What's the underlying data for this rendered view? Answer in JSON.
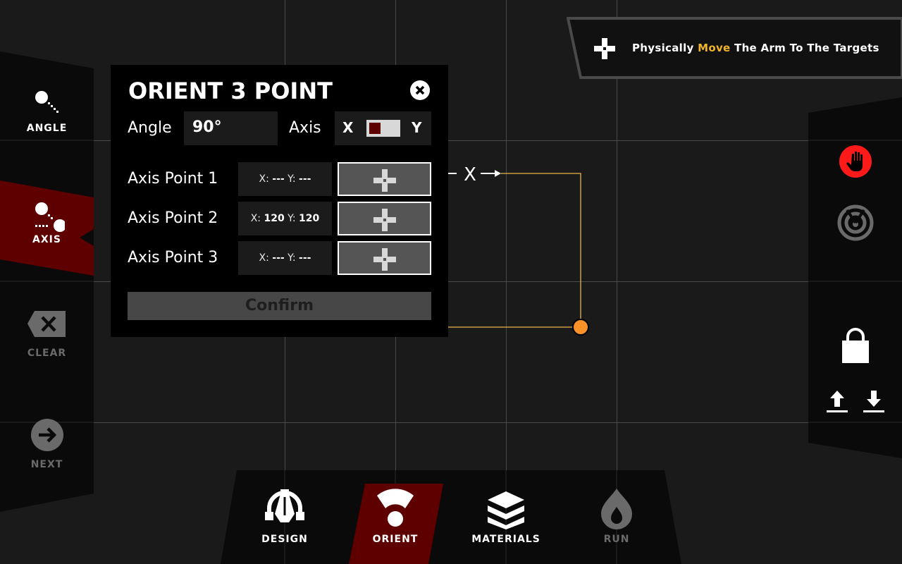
{
  "sidebar": {
    "items": [
      {
        "label": "ANGLE",
        "icon": "angle-icon",
        "active": false,
        "enabled": true
      },
      {
        "label": "AXIS",
        "icon": "axis-icon",
        "active": true,
        "enabled": true
      },
      {
        "label": "CLEAR",
        "icon": "clear-icon",
        "active": false,
        "enabled": false
      },
      {
        "label": "NEXT",
        "icon": "next-arrow-icon",
        "active": false,
        "enabled": false
      }
    ]
  },
  "dialog": {
    "title": "ORIENT 3 POINT",
    "angle_label": "Angle",
    "angle_value": "90°",
    "axis_label": "Axis",
    "axis_toggle": {
      "left": "X",
      "right": "Y",
      "selected": "X"
    },
    "points": [
      {
        "label": "Axis Point 1",
        "x_label": "X:",
        "x": "---",
        "y_label": "Y:",
        "y": "---"
      },
      {
        "label": "Axis Point 2",
        "x_label": "X:",
        "x": "120",
        "y_label": "Y:",
        "y": "120"
      },
      {
        "label": "Axis Point 3",
        "x_label": "X:",
        "x": "---",
        "y_label": "Y:",
        "y": "---"
      }
    ],
    "confirm_label": "Confirm"
  },
  "banner": {
    "icon": "crosshair-target-icon",
    "text_before": "Physically ",
    "text_highlight": "Move",
    "text_after": " The Arm To The Targets"
  },
  "canvas": {
    "axis_label": "X"
  },
  "right_bar": {
    "items": [
      "stop-hand-icon",
      "radar-icon",
      "lock-icon",
      "upload-icon",
      "download-icon"
    ]
  },
  "bottom_nav": {
    "items": [
      {
        "label": "DESIGN",
        "icon": "design-pen-icon",
        "active": false,
        "enabled": true
      },
      {
        "label": "ORIENT",
        "icon": "orient-icon",
        "active": true,
        "enabled": true
      },
      {
        "label": "MATERIALS",
        "icon": "layers-icon",
        "active": false,
        "enabled": true
      },
      {
        "label": "RUN",
        "icon": "flame-icon",
        "active": false,
        "enabled": false
      }
    ]
  },
  "colors": {
    "background": "#1a1a1a",
    "panel": "#0a0a0a",
    "active": "#5e0000",
    "highlight": "#f0b32a",
    "path_line": "#e8b84a",
    "point": "#f7922a",
    "stop": "#ff1a1a",
    "disabled": "#6a6a6a"
  }
}
